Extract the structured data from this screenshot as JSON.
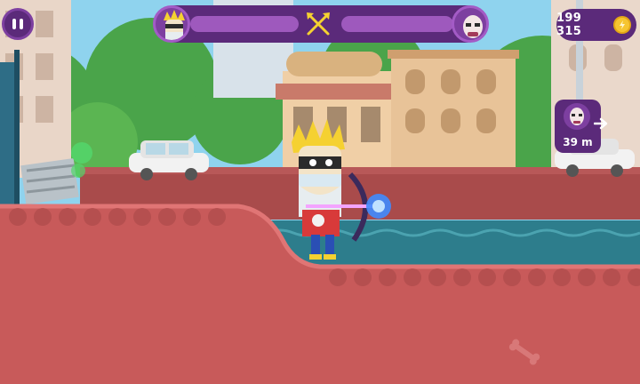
{
  "hud": {
    "pause": {
      "icon": "pause-icon"
    },
    "duel": {
      "player_avatar": "king-face-icon",
      "enemy_avatar": "bald-man-face-icon",
      "center_icon": "crossed-arrows-icon",
      "player_health": 1.0,
      "enemy_health": 1.0
    },
    "coins": {
      "value": "199 315",
      "icon": "coin-icon"
    },
    "enemy_indicator": {
      "distance": "39 m",
      "icon": "arrow-right-icon",
      "avatar": "bald-man-face-icon"
    }
  },
  "colors": {
    "hud_purple": "#5b2a7a",
    "ground_red": "#c85a5a",
    "water": "#2d7d8c",
    "sky": "#8fd3ee",
    "coin": "#f6c531"
  }
}
